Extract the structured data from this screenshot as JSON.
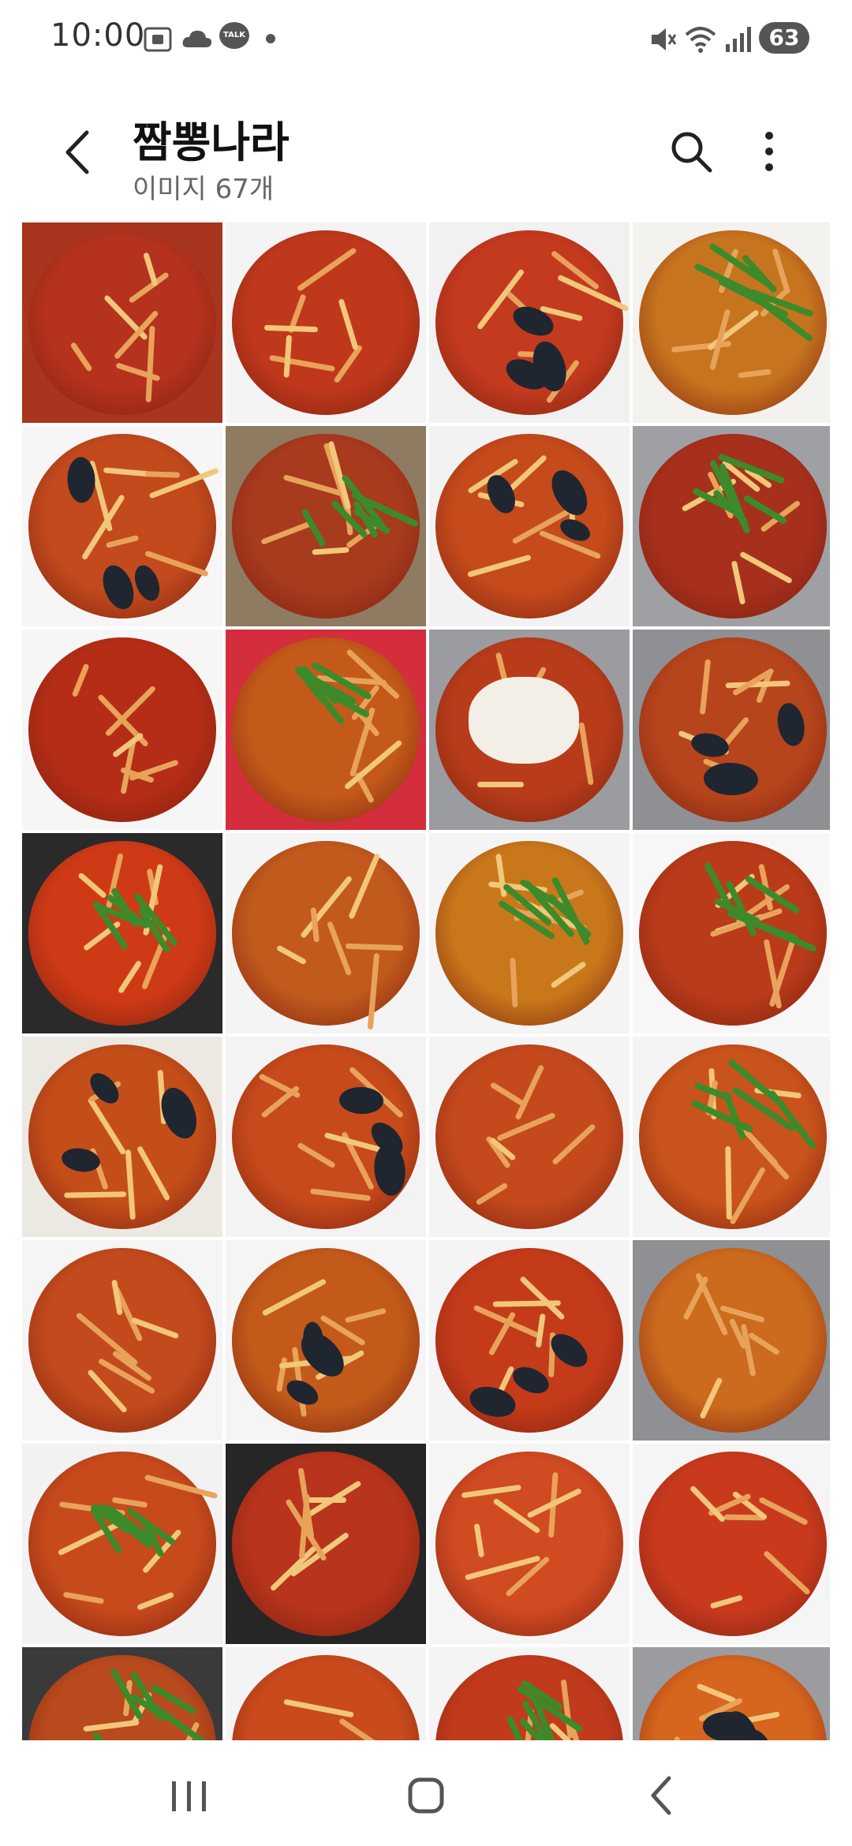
{
  "status_bar": {
    "time": "10:00",
    "battery": "63",
    "left_icons": [
      "screenshot-icon",
      "cloud-icon",
      "talk-icon",
      "dot-icon"
    ],
    "right_icons": [
      "mute-icon",
      "wifi-icon",
      "signal-icon",
      "battery-icon"
    ],
    "talk_text": "TALK"
  },
  "app_bar": {
    "title": "짬뽕나라",
    "subtitle": "이미지 67개"
  },
  "gallery": {
    "tile_count_visible": 32,
    "tiles": [
      {
        "soup": "#b4321e",
        "plate": "#a8351f",
        "accent": "noodle"
      },
      {
        "soup": "#c0381c",
        "plate": "#f4f4f4",
        "accent": "noodle"
      },
      {
        "soup": "#c43a1f",
        "plate": "#f1f1f1",
        "accent": "mussel"
      },
      {
        "soup": "#c7741f",
        "plate": "#f3f2ef",
        "accent": "veg"
      },
      {
        "soup": "#c24a1d",
        "plate": "#f6f6f6",
        "accent": "mussel"
      },
      {
        "soup": "#a83a1e",
        "plate": "#8e7b62",
        "accent": "veg"
      },
      {
        "soup": "#c54a1c",
        "plate": "#f2f2f2",
        "accent": "mussel"
      },
      {
        "soup": "#a7301d",
        "plate": "#9fa0a4",
        "accent": "veg"
      },
      {
        "soup": "#b52d16",
        "plate": "#f6f6f6",
        "accent": "noodle"
      },
      {
        "soup": "#c45a1a",
        "plate": "#d42d3c",
        "accent": "veg"
      },
      {
        "soup": "#b83c1a",
        "plate": "#9a9ca0",
        "accent": "white"
      },
      {
        "soup": "#b7451c",
        "plate": "#8e9094",
        "accent": "mussel"
      },
      {
        "soup": "#cf3a16",
        "plate": "#2a2a2a",
        "accent": "veg"
      },
      {
        "soup": "#c25a1d",
        "plate": "#f4f4f4",
        "accent": "noodle"
      },
      {
        "soup": "#c8781b",
        "plate": "#f4f4f4",
        "accent": "veg"
      },
      {
        "soup": "#b93b1a",
        "plate": "#f7f7f7",
        "accent": "veg"
      },
      {
        "soup": "#c44e1a",
        "plate": "#ece9e3",
        "accent": "mussel"
      },
      {
        "soup": "#c64a1b",
        "plate": "#f3f3f3",
        "accent": "mussel"
      },
      {
        "soup": "#c44a1d",
        "plate": "#f4f4f4",
        "accent": "noodle"
      },
      {
        "soup": "#c9531c",
        "plate": "#f4f4f4",
        "accent": "veg"
      },
      {
        "soup": "#c34a1d",
        "plate": "#f5f5f5",
        "accent": "noodle"
      },
      {
        "soup": "#c35a1a",
        "plate": "#f5f5f5",
        "accent": "mussel"
      },
      {
        "soup": "#c43b1a",
        "plate": "#f4f4f4",
        "accent": "mussel"
      },
      {
        "soup": "#cc6a1e",
        "plate": "#8e9094",
        "accent": "noodle"
      },
      {
        "soup": "#c74a1c",
        "plate": "#f2f2f2",
        "accent": "veg"
      },
      {
        "soup": "#b8341c",
        "plate": "#262626",
        "accent": "noodle"
      },
      {
        "soup": "#d04a22",
        "plate": "#f5f5f5",
        "accent": "noodle"
      },
      {
        "soup": "#c93a1d",
        "plate": "#f5f5f5",
        "accent": "noodle"
      },
      {
        "soup": "#b84a1d",
        "plate": "#3a3a3a",
        "accent": "veg"
      },
      {
        "soup": "#c94a1c",
        "plate": "#f4f4f4",
        "accent": "noodle"
      },
      {
        "soup": "#c23a1c",
        "plate": "#f4f4f4",
        "accent": "veg"
      },
      {
        "soup": "#d6651d",
        "plate": "#9a9ca0",
        "accent": "mussel"
      }
    ]
  },
  "nav_bar": {
    "items": [
      "recent-apps-icon",
      "home-icon",
      "back-icon"
    ]
  }
}
